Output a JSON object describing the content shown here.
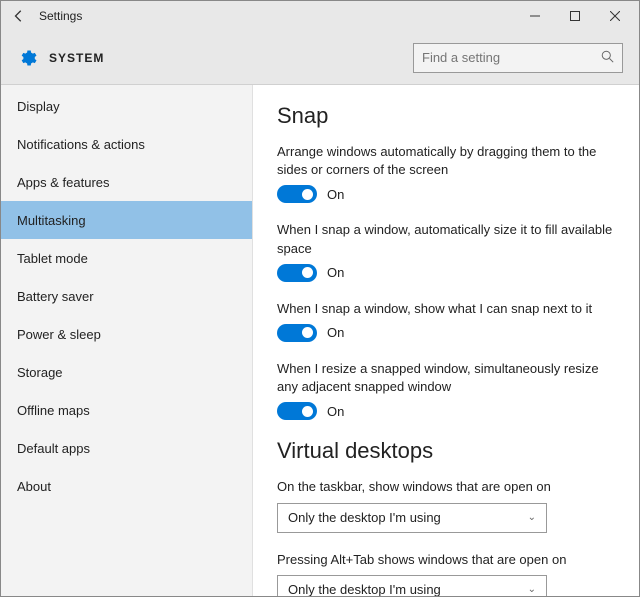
{
  "window": {
    "title": "Settings"
  },
  "header": {
    "breadcrumb": "SYSTEM"
  },
  "search": {
    "placeholder": "Find a setting"
  },
  "sidebar": {
    "items": [
      {
        "label": "Display"
      },
      {
        "label": "Notifications & actions"
      },
      {
        "label": "Apps & features"
      },
      {
        "label": "Multitasking"
      },
      {
        "label": "Tablet mode"
      },
      {
        "label": "Battery saver"
      },
      {
        "label": "Power & sleep"
      },
      {
        "label": "Storage"
      },
      {
        "label": "Offline maps"
      },
      {
        "label": "Default apps"
      },
      {
        "label": "About"
      }
    ],
    "selected_index": 3
  },
  "snap": {
    "heading": "Snap",
    "settings": [
      {
        "label": "Arrange windows automatically by dragging them to the sides or corners of the screen",
        "state": "On"
      },
      {
        "label": "When I snap a window, automatically size it to fill available space",
        "state": "On"
      },
      {
        "label": "When I snap a window, show what I can snap next to it",
        "state": "On"
      },
      {
        "label": "When I resize a snapped window, simultaneously resize any adjacent snapped window",
        "state": "On"
      }
    ]
  },
  "virtual_desktops": {
    "heading": "Virtual desktops",
    "settings": [
      {
        "label": "On the taskbar, show windows that are open on",
        "value": "Only the desktop I'm using"
      },
      {
        "label": "Pressing Alt+Tab shows windows that are open on",
        "value": "Only the desktop I'm using"
      }
    ]
  }
}
